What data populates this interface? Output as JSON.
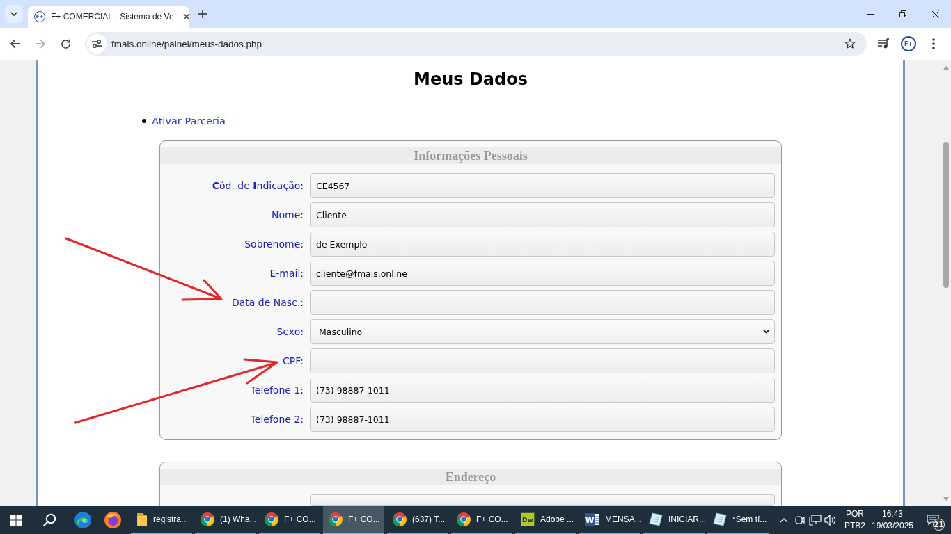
{
  "browser": {
    "tabs": [
      {
        "icon_label": "F+",
        "title": "F+ COMERCIAL - Sistema de Ve",
        "selected": true
      }
    ],
    "back": {
      "disabled": false
    },
    "forward": {
      "disabled": true
    },
    "url": "fmais.online/painel/meus-dados.php",
    "profile_label": "F+"
  },
  "page": {
    "title": "Meus Dados",
    "links": [
      "Ativar Parceria"
    ],
    "sections": [
      {
        "title": "Informações Pessoais",
        "fields": [
          {
            "label": "**C**ód. de **I**ndicação:",
            "kind": "text",
            "value": "CE4567"
          },
          {
            "label": "Nome:",
            "kind": "text",
            "value": "Cliente"
          },
          {
            "label": "Sobrenome:",
            "kind": "text",
            "value": "de Exemplo"
          },
          {
            "label": "E-mail:",
            "kind": "text",
            "value": "cliente@fmais.online"
          },
          {
            "label": "Data de Nasc.:",
            "kind": "text"
          },
          {
            "label": "Sexo:",
            "kind": "select",
            "value": "Masculino"
          },
          {
            "label": "CPF:",
            "kind": "text"
          },
          {
            "label": "Telefone 1:",
            "kind": "text",
            "value": "(73) 98887-1011"
          },
          {
            "label": "Telefone 2:",
            "kind": "text",
            "value": "(73) 98887-1011"
          }
        ]
      },
      {
        "title": "Endereço",
        "fields": [
          {
            "kind": "text"
          }
        ]
      }
    ]
  },
  "taskbar": {
    "tasks": [
      {
        "kind": "folder",
        "label": "registra...",
        "selected": false
      },
      {
        "kind": "chrome",
        "label": "(1) Wha...",
        "selected": false
      },
      {
        "kind": "chrome",
        "label": "F+ CO...",
        "selected": false
      },
      {
        "kind": "chrome",
        "label": "F+ CO...",
        "selected": true
      },
      {
        "kind": "chrome",
        "label": "(637) T...",
        "selected": false
      },
      {
        "kind": "chrome",
        "label": "F+ CO...",
        "selected": false
      },
      {
        "kind": "dreamweaver",
        "icon_label": "Dw",
        "label": "Adobe ...",
        "selected": false
      },
      {
        "kind": "word",
        "icon_label": "W",
        "label": "MENSA...",
        "selected": false
      },
      {
        "kind": "notepad",
        "label": "INICIAR...",
        "selected": false
      },
      {
        "kind": "notepad",
        "label": "*Sem tí...",
        "selected": false
      }
    ],
    "tray": {
      "language": "POR",
      "layout": "PTB2",
      "time": "16:43",
      "date": "19/03/2025",
      "notifications": "21"
    }
  }
}
